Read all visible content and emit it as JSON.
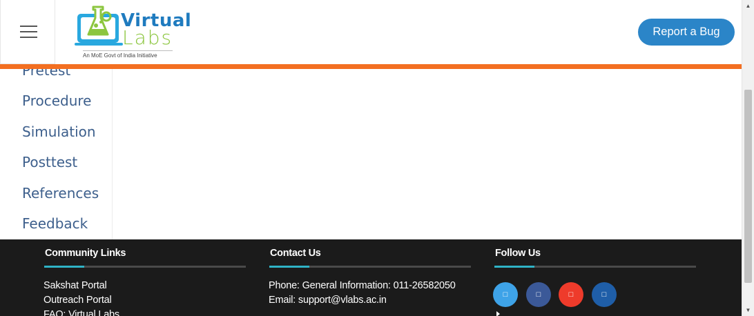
{
  "header": {
    "menu_icon": "hamburger-menu-icon",
    "logo": {
      "word1": "Virtual",
      "word2": "Labs",
      "tagline": "An MoE Govt of India Initiative"
    },
    "report_bug_label": "Report a Bug"
  },
  "colors": {
    "accent_orange": "#f36f21",
    "button_blue": "#2b85c8",
    "sidebar_text": "#3d5f8c",
    "footer_bg": "#1b1b1b",
    "footer_accent": "#2fb3c6"
  },
  "sidebar": {
    "items": [
      {
        "label": "Pretest"
      },
      {
        "label": "Procedure"
      },
      {
        "label": "Simulation"
      },
      {
        "label": "Posttest"
      },
      {
        "label": "References"
      },
      {
        "label": "Feedback"
      }
    ]
  },
  "footer": {
    "community": {
      "title": "Community Links",
      "links": [
        "Sakshat Portal",
        "Outreach Portal",
        "FAQ: Virtual Labs"
      ]
    },
    "contact": {
      "title": "Contact Us",
      "phone": "Phone: General Information: 011-26582050",
      "email": "Email: support@vlabs.ac.in"
    },
    "follow": {
      "title": "Follow Us",
      "icons": [
        {
          "name": "twitter-icon",
          "color": "#3ea3e8"
        },
        {
          "name": "facebook-icon",
          "color": "#3b5998"
        },
        {
          "name": "youtube-icon",
          "color": "#ee3b2b"
        },
        {
          "name": "linkedin-icon",
          "color": "#1f5ea8"
        }
      ]
    }
  }
}
